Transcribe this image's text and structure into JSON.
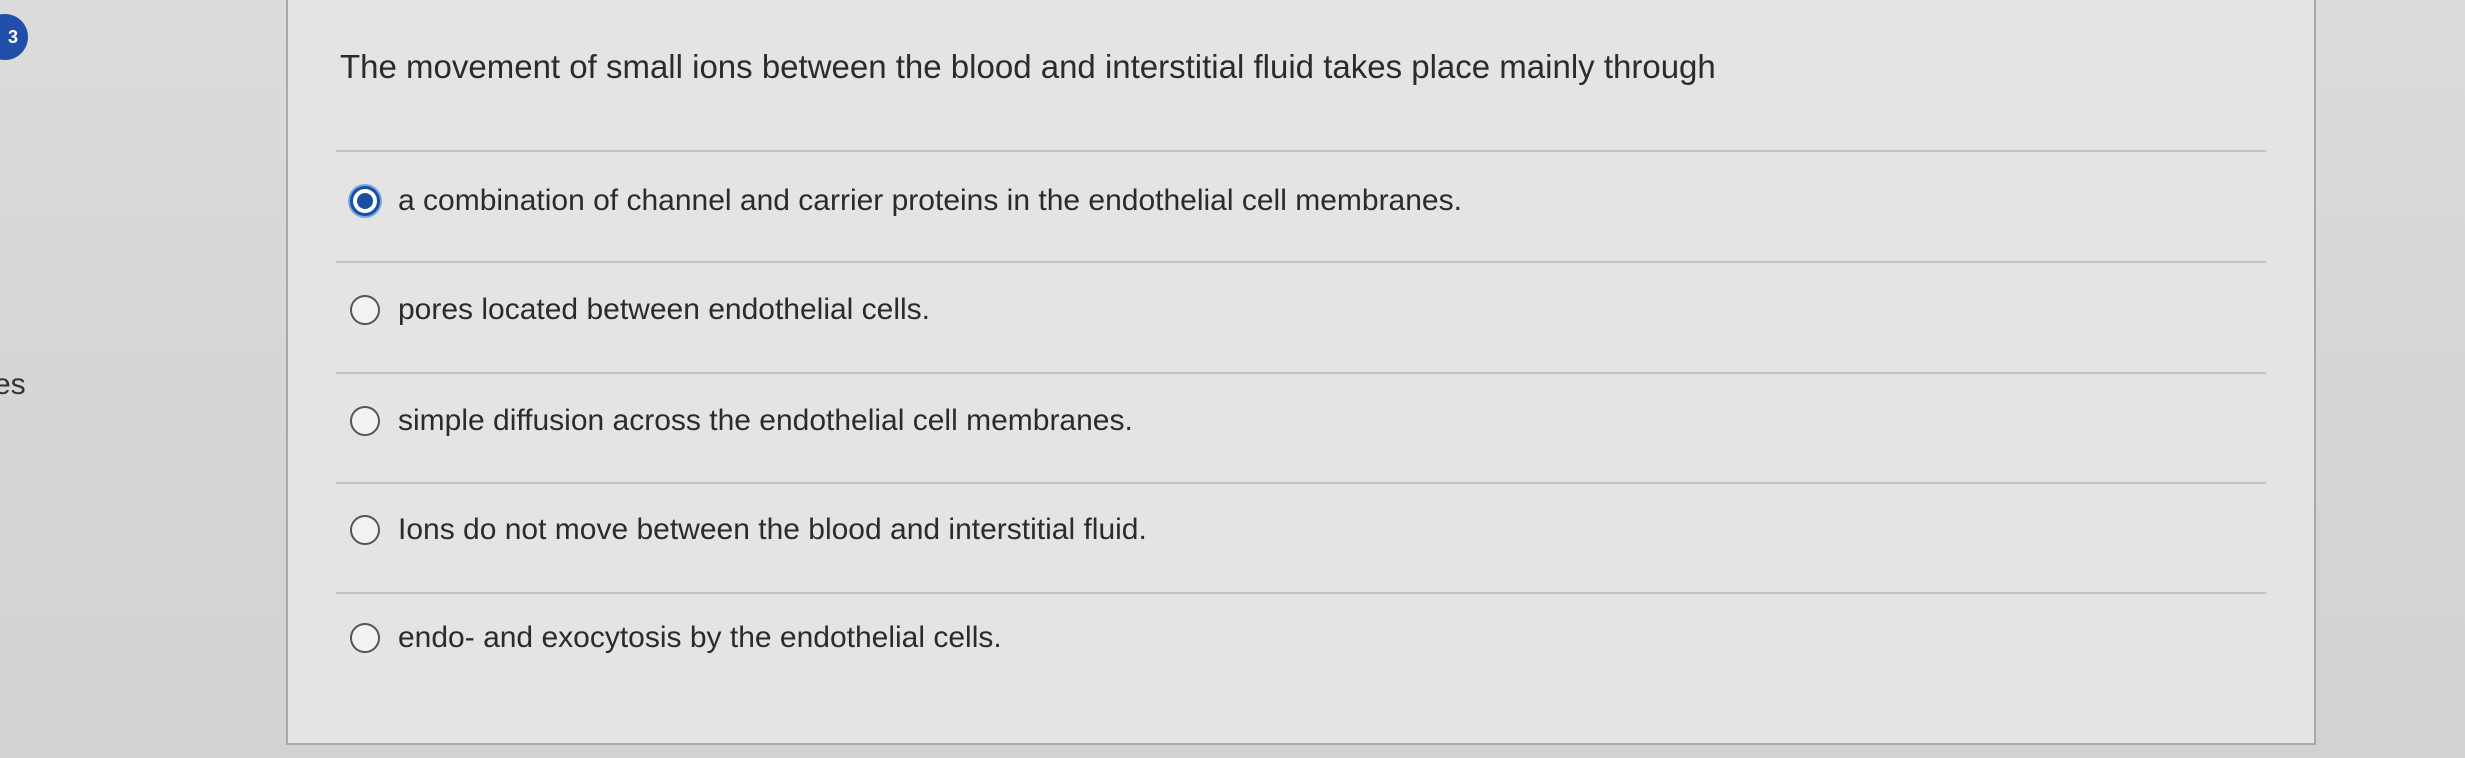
{
  "left_badge": "3",
  "left_edge_text": "es",
  "question": {
    "text": "The movement of small ions between the blood and interstitial fluid takes place mainly through"
  },
  "options": [
    {
      "label": "a combination of channel and carrier proteins in the endothelial cell membranes.",
      "selected": true
    },
    {
      "label": "pores located between endothelial cells.",
      "selected": false
    },
    {
      "label": "simple diffusion across the endothelial cell membranes.",
      "selected": false
    },
    {
      "label": "Ions do not move between the blood and interstitial fluid.",
      "selected": false
    },
    {
      "label": "endo- and exocytosis by the endothelial cells.",
      "selected": false
    }
  ],
  "colors": {
    "selected_radio": "#1a4fa0",
    "text": "#2b2b2b"
  }
}
